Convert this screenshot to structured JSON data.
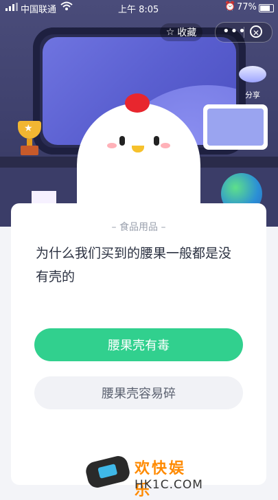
{
  "status_bar": {
    "carrier": "中国联通",
    "time": "上午 8:05",
    "battery": "77%"
  },
  "header": {
    "favorite_label": "收藏",
    "more_label": "•••",
    "close_label": "✕",
    "share_label": "分享"
  },
  "quiz": {
    "category": "– 食品用品 –",
    "question": "为什么我们买到的腰果一般都是没有壳的",
    "options": [
      {
        "label": "腰果壳有毒",
        "state": "primary"
      },
      {
        "label": "腰果壳容易碎",
        "state": "secondary"
      }
    ]
  },
  "watermark": {
    "brand": "欢快娱乐",
    "site": "HK1C.COM"
  },
  "colors": {
    "primary_green": "#31d08e",
    "scene_bg": "#3d3f6b",
    "card_bg": "#ffffff"
  }
}
